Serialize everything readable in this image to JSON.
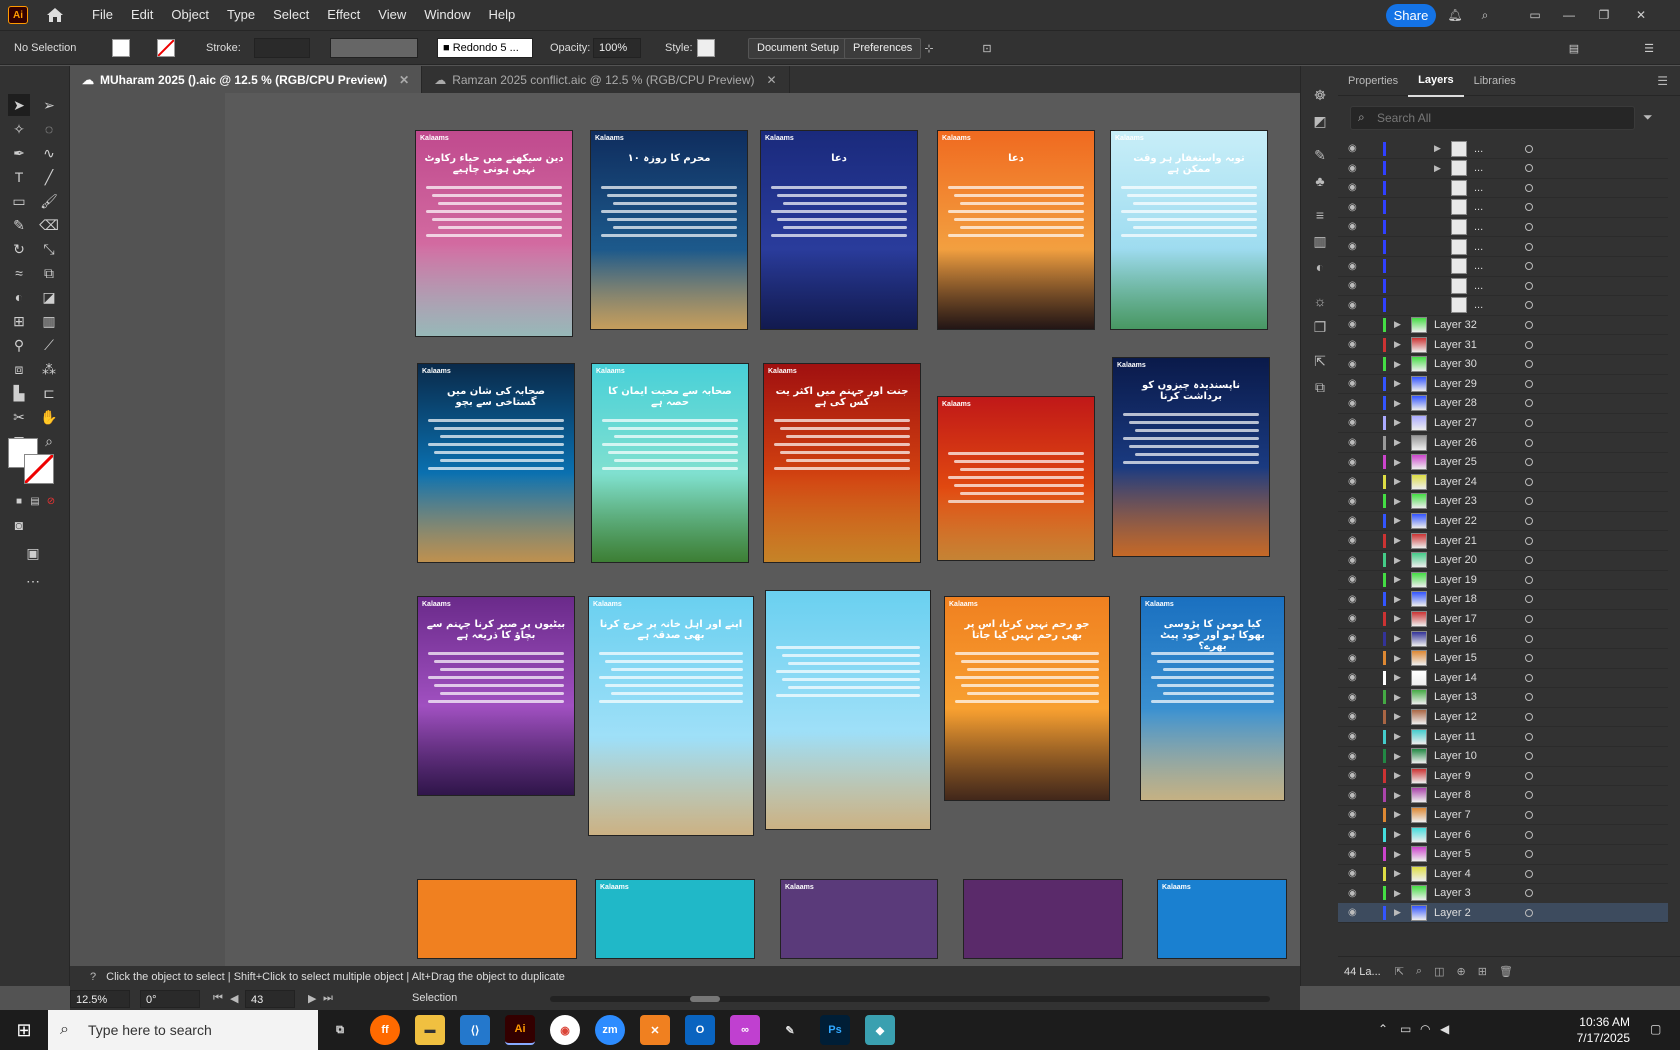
{
  "app": {
    "logo": "Ai"
  },
  "menu": [
    "File",
    "Edit",
    "Object",
    "Type",
    "Select",
    "Effect",
    "View",
    "Window",
    "Help"
  ],
  "share_label": "Share",
  "control": {
    "selection": "No Selection",
    "stroke_label": "Stroke:",
    "brush": "Redondo 5 ...",
    "opacity_label": "Opacity:",
    "opacity_value": "100%",
    "style_label": "Style:",
    "doc_setup": "Document Setup",
    "preferences": "Preferences"
  },
  "tabs": [
    {
      "label": "MUharam 2025 ().aic @ 12.5 % (RGB/CPU Preview)",
      "active": true
    },
    {
      "label": "Ramzan 2025 conflict.aic @ 12.5 % (RGB/CPU Preview)",
      "active": false
    }
  ],
  "panel": {
    "tabs": [
      "Properties",
      "Layers",
      "Libraries"
    ],
    "active_tab": "Layers",
    "search_placeholder": "Search All",
    "layers_count": "44 La...",
    "layers": [
      {
        "name": "...",
        "color": "#3040ff",
        "sub": true
      },
      {
        "name": "...",
        "color": "#3040ff",
        "sub": true
      },
      {
        "name": "...",
        "color": "#3040ff",
        "sub": true
      },
      {
        "name": "...",
        "color": "#3040ff",
        "sub": true
      },
      {
        "name": "...",
        "color": "#3040ff",
        "sub": true
      },
      {
        "name": "...",
        "color": "#3040ff",
        "sub": true
      },
      {
        "name": "...",
        "color": "#3040ff",
        "sub": true
      },
      {
        "name": "...",
        "color": "#3040ff",
        "sub": true
      },
      {
        "name": "...",
        "color": "#3040ff",
        "sub": true
      },
      {
        "name": "Layer 32",
        "color": "#44dd44"
      },
      {
        "name": "Layer 31",
        "color": "#cc3333"
      },
      {
        "name": "Layer 30",
        "color": "#44dd44"
      },
      {
        "name": "Layer 29",
        "color": "#3355ff"
      },
      {
        "name": "Layer 28",
        "color": "#3355ff"
      },
      {
        "name": "Layer 27",
        "color": "#aaaaff"
      },
      {
        "name": "Layer 26",
        "color": "#999999"
      },
      {
        "name": "Layer 25",
        "color": "#cc44cc"
      },
      {
        "name": "Layer 24",
        "color": "#dddd44"
      },
      {
        "name": "Layer 23",
        "color": "#44dd44"
      },
      {
        "name": "Layer 22",
        "color": "#3355ff"
      },
      {
        "name": "Layer 21",
        "color": "#cc3333"
      },
      {
        "name": "Layer 20",
        "color": "#44cc88"
      },
      {
        "name": "Layer 19",
        "color": "#44dd44"
      },
      {
        "name": "Layer 18",
        "color": "#3355ff"
      },
      {
        "name": "Layer 17",
        "color": "#cc3333"
      },
      {
        "name": "Layer 16",
        "color": "#333399"
      },
      {
        "name": "Layer 15",
        "color": "#dd8833"
      },
      {
        "name": "Layer 14",
        "color": "#ffffff"
      },
      {
        "name": "Layer 13",
        "color": "#44aa44"
      },
      {
        "name": "Layer 12",
        "color": "#aa6644"
      },
      {
        "name": "Layer 11",
        "color": "#44cccc"
      },
      {
        "name": "Layer 10",
        "color": "#228844"
      },
      {
        "name": "Layer 9",
        "color": "#cc3333"
      },
      {
        "name": "Layer 8",
        "color": "#aa44aa"
      },
      {
        "name": "Layer 7",
        "color": "#dd8833"
      },
      {
        "name": "Layer 6",
        "color": "#44dddd"
      },
      {
        "name": "Layer 5",
        "color": "#cc44cc"
      },
      {
        "name": "Layer 4",
        "color": "#dddd44"
      },
      {
        "name": "Layer 3",
        "color": "#44dd44"
      },
      {
        "name": "Layer 2",
        "color": "#3355ff",
        "selected": true
      }
    ]
  },
  "hint": "Click the object to select  |  Shift+Click to select multiple object  |  Alt+Drag the object to duplicate",
  "status": {
    "zoom": "12.5%",
    "rotation": "0°",
    "artboard": "43",
    "mode": "Selection"
  },
  "cards": [
    {
      "title": "دین سیکھنے میں حیاء رکاوٹ نہیں ہونی چاہیے",
      "bg": "linear-gradient(#c04a8e,#d26aa0 55%,#b8e0e0)",
      "brand": "Kalaams"
    },
    {
      "title": "۱۰ محرم کا روزہ",
      "bg": "linear-gradient(#0f2d5e,#1d5a8c 60%,#f0c070)",
      "brand": "Kalaams"
    },
    {
      "title": "دعا",
      "bg": "linear-gradient(#1a2a7c,#2a3c9c 60%,#162060)",
      "brand": "Kalaams"
    },
    {
      "title": "دعا",
      "bg": "linear-gradient(#f06a20,#f3a040 60%,#2a1a1a)",
      "brand": "Kalaams"
    },
    {
      "title": "توبہ واستغفار ہر وقت ممکن ہے",
      "bg": "linear-gradient(#c8eef8,#9edcf0 60%,#58b878)",
      "brand": "Kalaams"
    },
    {
      "title": "صحابہ کی شان میں گستاخی سے بچو",
      "bg": "linear-gradient(#0a2a4a,#0a70b0 55%,#e8b060)",
      "brand": "Kalaams"
    },
    {
      "title": "صحابہ سے محبت ایمان کا حصہ ہے",
      "bg": "linear-gradient(#48d0d8,#80e0d0 55%,#4a9a40)",
      "brand": "Kalaams"
    },
    {
      "title": "جنت اور جہنم میں اکثر یت کس کی ہے",
      "bg": "linear-gradient(#a01010,#d04010 55%,#f0a030)",
      "brand": "Kalaams"
    },
    {
      "title": "",
      "bg": "linear-gradient(#c01818,#e04810 55%,#f0a040)",
      "brand": "Kalaams"
    },
    {
      "title": "ناپسندیدہ چیزوں کو برداشت کرنا",
      "bg": "linear-gradient(#0a1a4a,#1a3a80 55%,#f08030)",
      "brand": "Kalaams"
    },
    {
      "title": "بیٹیوں پر صبر کرنا جہنم سے بچاؤ کا ذریعہ ہے",
      "bg": "linear-gradient(#6a2a8a,#a050c0 55%,#3a1a5a)",
      "brand": "Kalaams"
    },
    {
      "title": "اپنے اور اہل خانہ پر خرچ کرنا بھی صدقہ ہے",
      "bg": "linear-gradient(#6ad0f0,#a0e0f8 60%,#f8d8a0)",
      "brand": "Kalaams"
    },
    {
      "title": "",
      "bg": "linear-gradient(#6ad0f0,#a0e0f8 60%,#f8d8a0)",
      "brand": ""
    },
    {
      "title": "جو رحم نہیں کرتا، اس پر بھی رحم نہیں کیا جاتا",
      "bg": "linear-gradient(#f08020,#f8a030 55%,#503020)",
      "brand": "Kalaams"
    },
    {
      "title": "کیا مومن کا پڑوسی بھوکا ہو اور خود پیٹ بھرے؟",
      "bg": "linear-gradient(#1a70c0,#3a90d0 55%,#f0d8a0)",
      "brand": "Kalaams"
    },
    {
      "title": "",
      "bg": "#f08020",
      "brand": ""
    },
    {
      "title": "",
      "bg": "#20b8c8",
      "brand": "Kalaams"
    },
    {
      "title": "",
      "bg": "#5a3a7a",
      "brand": "Kalaams"
    },
    {
      "title": "",
      "bg": "#5a2a6a",
      "brand": ""
    },
    {
      "title": "",
      "bg": "#1a80d0",
      "brand": "Kalaams"
    }
  ],
  "taskbar": {
    "search_placeholder": "Type here to search",
    "time": "10:36 AM",
    "date": "7/17/2025"
  }
}
